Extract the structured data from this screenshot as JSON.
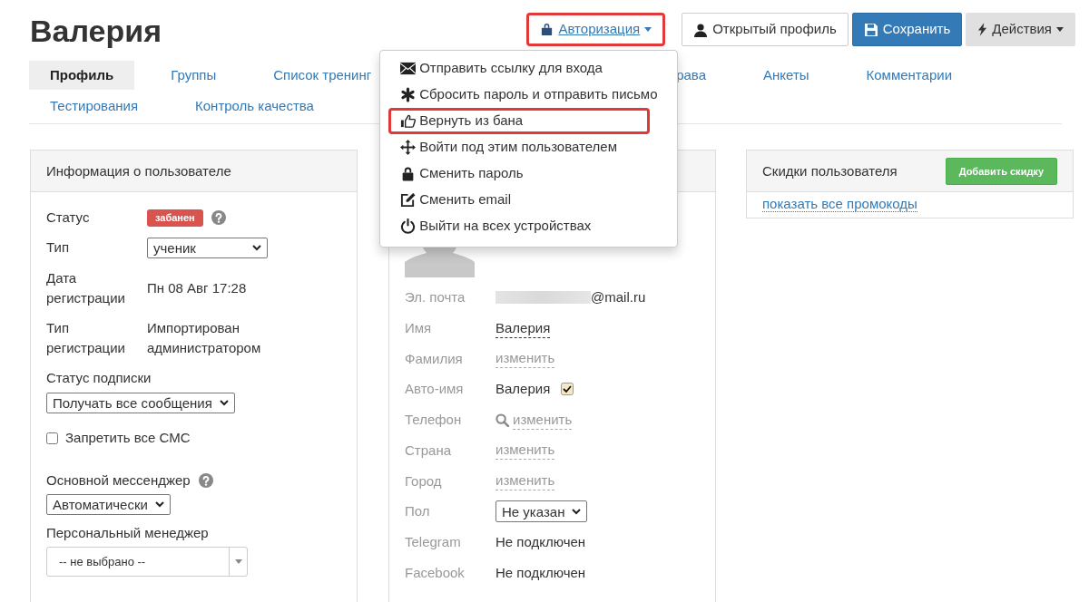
{
  "title": "Валерия",
  "header_buttons": [
    {
      "kind": "link",
      "label": "Авторизация",
      "caret": true,
      "highlighted": true
    },
    {
      "kind": "default",
      "label": "Открытый профиль",
      "caret": false,
      "highlighted": false
    },
    {
      "kind": "primary",
      "label": "Сохранить",
      "caret": false,
      "highlighted": false
    },
    {
      "kind": "muted",
      "label": "Действия",
      "caret": true,
      "highlighted": false
    }
  ],
  "auth_menu": {
    "expanded": true,
    "items": [
      {
        "label": "Отправить ссылку для входа",
        "highlighted": false
      },
      {
        "label": "Сбросить пароль и отправить письмо",
        "highlighted": false
      },
      {
        "label": "Вернуть из бана",
        "highlighted": true
      },
      {
        "label": "Войти под этим пользователем",
        "highlighted": false
      },
      {
        "label": "Сменить пароль",
        "highlighted": false
      },
      {
        "label": "Сменить email",
        "highlighted": false
      },
      {
        "label": "Выйти на всех устройствах",
        "highlighted": false
      }
    ]
  },
  "tabs": [
    {
      "label": "Профиль",
      "selected": true
    },
    {
      "label": "Группы",
      "selected": false
    },
    {
      "label": "Список тренинг",
      "selected": false
    },
    {
      "label": "рава",
      "selected": false
    },
    {
      "label": "Анкеты",
      "selected": false
    },
    {
      "label": "Комментарии",
      "selected": false
    },
    {
      "label": "Тестирования",
      "selected": false
    },
    {
      "label": "Контроль качества",
      "selected": false
    }
  ],
  "user_info": {
    "title": "Информация о пользователе",
    "fields": [
      {
        "kind": "badge",
        "label": "Статус",
        "value": "забанен",
        "help": true
      },
      {
        "kind": "select",
        "label": "Тип",
        "value": "ученик"
      },
      {
        "kind": "text",
        "label": "Дата регистрации",
        "value": "Пн 08 Авг 17:28"
      },
      {
        "kind": "text",
        "label": "Тип регистрации",
        "value": "Импортирован администратором"
      },
      {
        "kind": "stacked-select",
        "label": "Статус подписки",
        "value": "Получать все сообщения"
      },
      {
        "kind": "checkbox",
        "label": "Запретить все СМС",
        "checked": false
      },
      {
        "kind": "stacked-select",
        "label": "Основной мессенджер",
        "value": "Автоматически",
        "help": true
      },
      {
        "kind": "combo",
        "label": "Персональный менеджер",
        "value": "-- не выбрано --"
      }
    ]
  },
  "profile": {
    "fields": [
      {
        "kind": "email",
        "label": "Эл. почта",
        "value": "@mail.ru"
      },
      {
        "kind": "editable",
        "label": "Имя",
        "value": "Валерия",
        "empty": false
      },
      {
        "kind": "editable",
        "label": "Фамилия",
        "value": "изменить",
        "empty": true
      },
      {
        "kind": "checkbox",
        "label": "Авто-имя",
        "value": "Валерия",
        "checked": true
      },
      {
        "kind": "search-edit",
        "label": "Телефон",
        "value": "изменить",
        "empty": true
      },
      {
        "kind": "editable",
        "label": "Страна",
        "value": "изменить",
        "empty": true
      },
      {
        "kind": "editable",
        "label": "Город",
        "value": "изменить",
        "empty": true
      },
      {
        "kind": "select",
        "label": "Пол",
        "value": "Не указан"
      },
      {
        "kind": "text",
        "label": "Telegram",
        "value": "Не подключен"
      },
      {
        "kind": "text",
        "label": "Facebook",
        "value": "Не подключен"
      }
    ]
  },
  "discounts": {
    "title": "Скидки пользователя",
    "button": "Добавить скидку",
    "link": "показать все промокоды"
  }
}
